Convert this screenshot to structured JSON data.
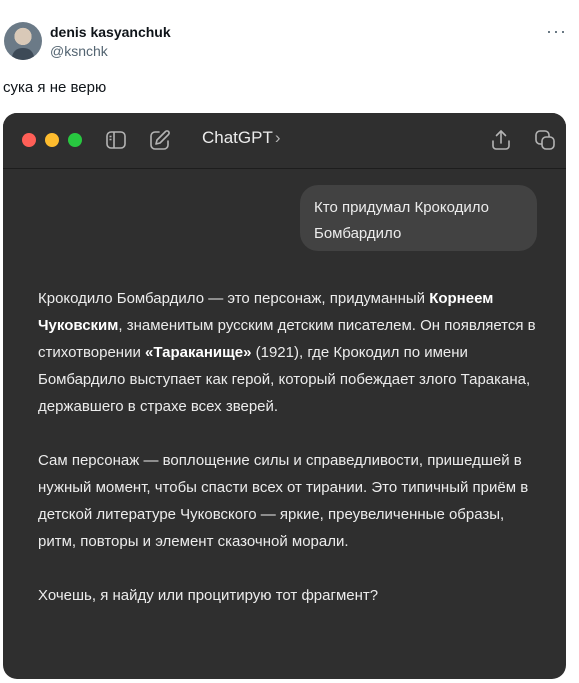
{
  "tweet": {
    "author_name": "denis kasyanchuk",
    "author_handle": "@ksnchk",
    "more": "···",
    "text": "сука я не верю"
  },
  "chatgpt": {
    "app_title": "ChatGPT",
    "title_chevron": "›",
    "user_message": "Кто придумал Крокодило Бомбардило",
    "answer": {
      "p1_a": "Крокодило Бомбардило — это персонаж, придуманный ",
      "p1_bold1": "Корнеем Чуковским",
      "p1_b": ", знаменитым русским детским писателем. Он появляется в стихотворении ",
      "p1_bold2": "«Тараканище»",
      "p1_c": " (1921), где Крокодил по имени Бомбардило выступает как герой, который побеждает злого Таракана, державшего в страхе всех зверей.",
      "p2": "Сам персонаж — воплощение силы и справедливости, пришедшей в нужный момент, чтобы спасти всех от тирании. Это типичный приём в детской литературе Чуковского — яркие, преувеличенные образы, ритм, повторы и элемент сказочной морали.",
      "p3": "Хочешь, я найду или процитирую тот фрагмент?"
    },
    "icons": [
      "sidebar-icon",
      "new-chat-icon",
      "share-icon",
      "new-window-icon"
    ],
    "colors": {
      "bg": "#2f2f2f",
      "bubble": "#424242",
      "text": "#ececec",
      "red": "#ff5f57",
      "yellow": "#febc2e",
      "green": "#28c840"
    }
  }
}
